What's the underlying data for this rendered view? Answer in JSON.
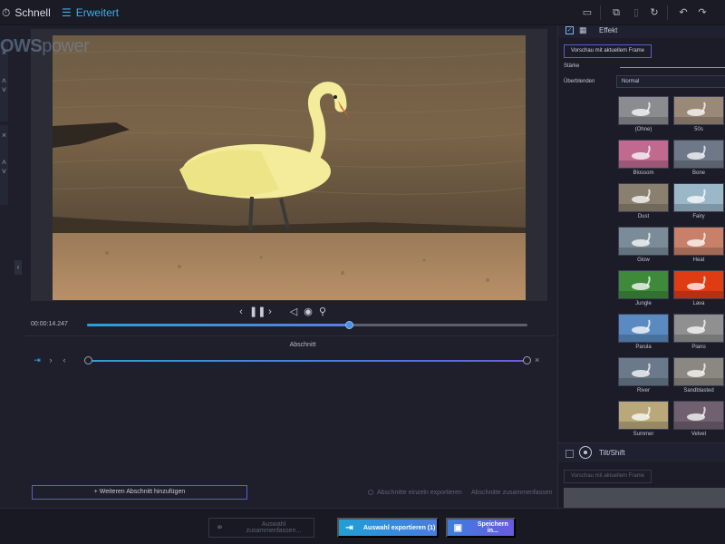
{
  "topbar": {
    "mode_quick": "Schnell",
    "mode_advanced": "Erweitert",
    "icons": [
      "folder-icon",
      "copy-icon",
      "paste-icon",
      "rotate-icon",
      "undo-icon",
      "redo-icon"
    ]
  },
  "preview": {
    "watermark_bold": "OWS",
    "watermark_light": "power"
  },
  "player": {
    "timecode": "00:00:14.247",
    "progress": 0.595
  },
  "sections": {
    "title": "Abschnitt",
    "add_button": "Weiteren Abschnitt hinzufügen",
    "export_separately": "Abschnitte einzeln exportieren",
    "merge_sections": "Abschnitte zusammenfassen",
    "range_start": 0.0,
    "range_end": 1.0
  },
  "effect_panel": {
    "title": "Effekt",
    "checked": true,
    "preview_button": "Vorschau mit aktuellem Frame",
    "strength_label": "Stärke",
    "blend_label": "Überblenden",
    "blend_value": "Normal",
    "presets": [
      {
        "name": "(Ohne)"
      },
      {
        "name": "50s"
      },
      {
        "name": "Blossom"
      },
      {
        "name": "Bone"
      },
      {
        "name": "Dust"
      },
      {
        "name": "Fairy"
      },
      {
        "name": "Glow"
      },
      {
        "name": "Heat"
      },
      {
        "name": "Jungle"
      },
      {
        "name": "Lava"
      },
      {
        "name": "Parula"
      },
      {
        "name": "Piano"
      },
      {
        "name": "River"
      },
      {
        "name": "Sandblasted"
      },
      {
        "name": "Summer"
      },
      {
        "name": "Velvet"
      }
    ],
    "preset_colors": [
      "#8a8c90",
      "#9a8878",
      "#c06a90",
      "#6e7888",
      "#8a8070",
      "#9ab8c8",
      "#7a8c98",
      "#c88068",
      "#3e8a3a",
      "#e03c14",
      "#5a8ac0",
      "#909090",
      "#6a7a8a",
      "#8a8880",
      "#b8a87a",
      "#706070"
    ]
  },
  "tiltshift_panel": {
    "title": "Tilt/Shift",
    "checked": false,
    "preview_button": "Vorschau mit aktuellem Frame"
  },
  "bottombar": {
    "merge_selection": "Auswahl zusammenfassen...",
    "export_selection": "Auswahl exportieren (1)",
    "save_as": "Speichern in..."
  }
}
